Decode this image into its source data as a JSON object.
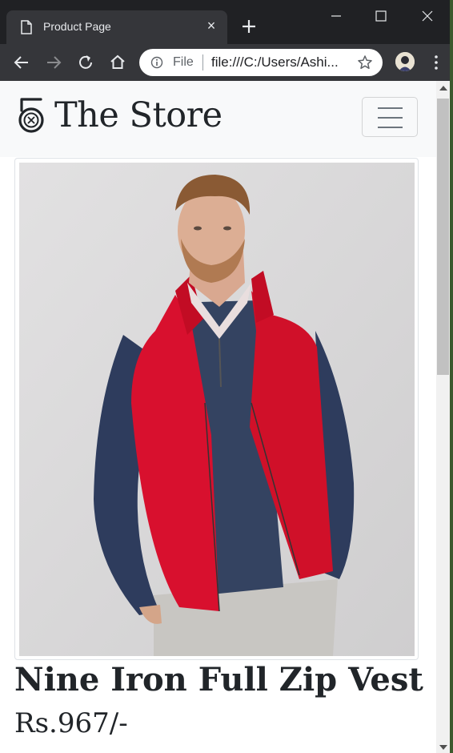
{
  "browser": {
    "tab_title": "Product Page",
    "tab_close": "×",
    "omnibox_scheme": "File",
    "url": "file:///C:/Users/Ashi..."
  },
  "store": {
    "brand_name": "The Store"
  },
  "product": {
    "name": "Nine Iron Full Zip Vest",
    "price": "Rs.967/-"
  },
  "colors": {
    "chrome_dark": "#202124",
    "toolbar": "#35363a",
    "navbar_bg": "#f8f9fa",
    "text": "#212529",
    "vest_red": "#d8102e",
    "shirt_navy": "#2f3d5c"
  },
  "icons": [
    "page-icon",
    "close-icon",
    "plus-icon",
    "minimize-icon",
    "maximize-icon",
    "window-close-icon",
    "back-arrow-icon",
    "forward-arrow-icon",
    "reload-icon",
    "home-icon",
    "info-icon",
    "star-icon",
    "kebab-menu-icon",
    "store-logo-icon",
    "hamburger-icon"
  ]
}
